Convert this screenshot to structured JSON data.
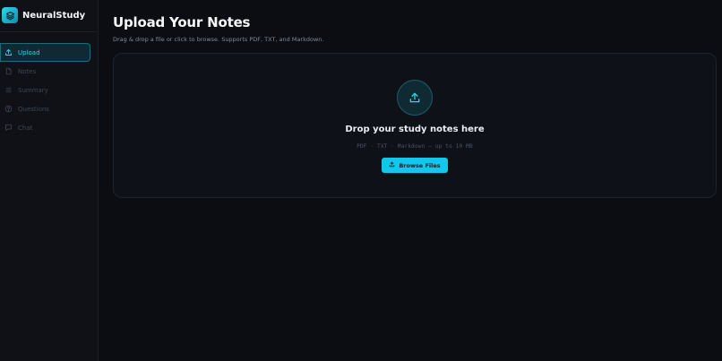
{
  "app": {
    "name": "NeuralStudy"
  },
  "sidebar": {
    "items": [
      {
        "label": "Upload",
        "icon": "upload-icon",
        "active": true
      },
      {
        "label": "Notes",
        "icon": "document-icon",
        "active": false
      },
      {
        "label": "Summary",
        "icon": "list-icon",
        "active": false
      },
      {
        "label": "Questions",
        "icon": "help-circle-icon",
        "active": false
      },
      {
        "label": "Chat",
        "icon": "chat-icon",
        "active": false
      }
    ]
  },
  "main": {
    "title": "Upload Your Notes",
    "subtitle": "Drag & drop a file or click to browse. Supports PDF, TXT, and Markdown.",
    "dropzone": {
      "title": "Drop your study notes here",
      "hint": "PDF · TXT · Markdown — up to 10 MB",
      "browse_label": "Browse Files"
    }
  },
  "colors": {
    "accent": "#12c6ec",
    "background": "#0b0d12",
    "sidebar": "#0f1116"
  }
}
